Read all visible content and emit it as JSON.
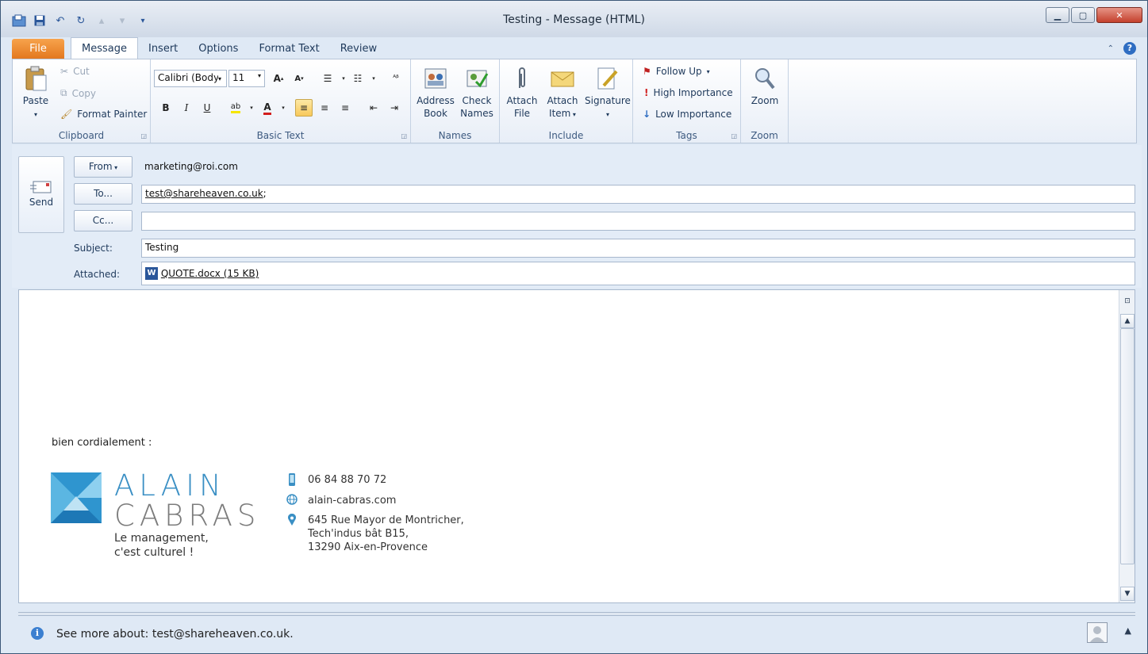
{
  "window": {
    "title": "Testing  -  Message (HTML)"
  },
  "tabs": [
    "File",
    "Message",
    "Insert",
    "Options",
    "Format Text",
    "Review"
  ],
  "ribbon": {
    "clipboard": {
      "paste": "Paste",
      "cut": "Cut",
      "copy": "Copy",
      "format_painter": "Format Painter",
      "label": "Clipboard"
    },
    "basic_text": {
      "font": "Calibri (Body)",
      "size": "11",
      "label": "Basic Text"
    },
    "names": {
      "address_book": [
        "Address",
        "Book"
      ],
      "check_names": [
        "Check",
        "Names"
      ],
      "label": "Names"
    },
    "include": {
      "attach_file": [
        "Attach",
        "File"
      ],
      "attach_item": [
        "Attach",
        "Item"
      ],
      "signature": "Signature",
      "label": "Include"
    },
    "tags": {
      "follow_up": "Follow Up",
      "high_importance": "High Importance",
      "low_importance": "Low Importance",
      "label": "Tags"
    },
    "zoom": {
      "zoom": "Zoom",
      "label": "Zoom"
    }
  },
  "header": {
    "send": "Send",
    "from_button": "From",
    "from_value": "marketing@roi.com",
    "to_button": "To...",
    "to_value": "test@shareheaven.co.uk",
    "to_suffix": ";",
    "cc_button": "Cc...",
    "cc_value": "",
    "subject_label": "Subject:",
    "subject_value": "Testing",
    "attached_label": "Attached:",
    "attachment": "QUOTE.docx (15 KB)"
  },
  "body": {
    "greeting": "bien cordialement :",
    "brand_line1": "ALAIN",
    "brand_line2": "CABRAS",
    "tagline1": "Le management,",
    "tagline2": "c'est culturel !",
    "phone": "06 84 88 70 72",
    "website": "alain-cabras.com",
    "address1": "645 Rue Mayor de Montricher,",
    "address2": "Tech'indus bât B15,",
    "address3": "13290 Aix-en-Provence"
  },
  "status": {
    "see_more": "See more about: test@shareheaven.co.uk."
  },
  "colors": {
    "brand_blue": "#3a8fc4",
    "brand_gray": "#7c7c7c",
    "file_tab": "#e3781f"
  }
}
